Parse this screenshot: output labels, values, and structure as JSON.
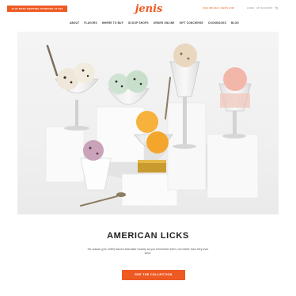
{
  "topbar": {
    "promo": "FLAT RATE SHIPPING STARTING AT $15",
    "logo": "jenis",
    "phone": "(614) 488-3224 / JENI'S.COM",
    "utils": [
      "LOGIN",
      "MY ACCOUNT"
    ]
  },
  "nav": {
    "items": [
      "ABOUT",
      "FLAVORS",
      "WHERE TO BUY",
      "SCOOP SHOPS",
      "ORDER ONLINE",
      "GIFT CONCIERGE",
      "COOKBOOKS",
      "BLOG"
    ]
  },
  "section": {
    "title": "AMERICAN LICKS",
    "description": "Six classic (pre-1980) flavors that taste exactly as you remember them, but better than they ever were.",
    "cta_label": "SEE THE COLLECTION"
  },
  "colors": {
    "accent": "#ee5a24",
    "text": "#222222",
    "muted": "#555555"
  },
  "icons": [
    "cart-icon"
  ]
}
